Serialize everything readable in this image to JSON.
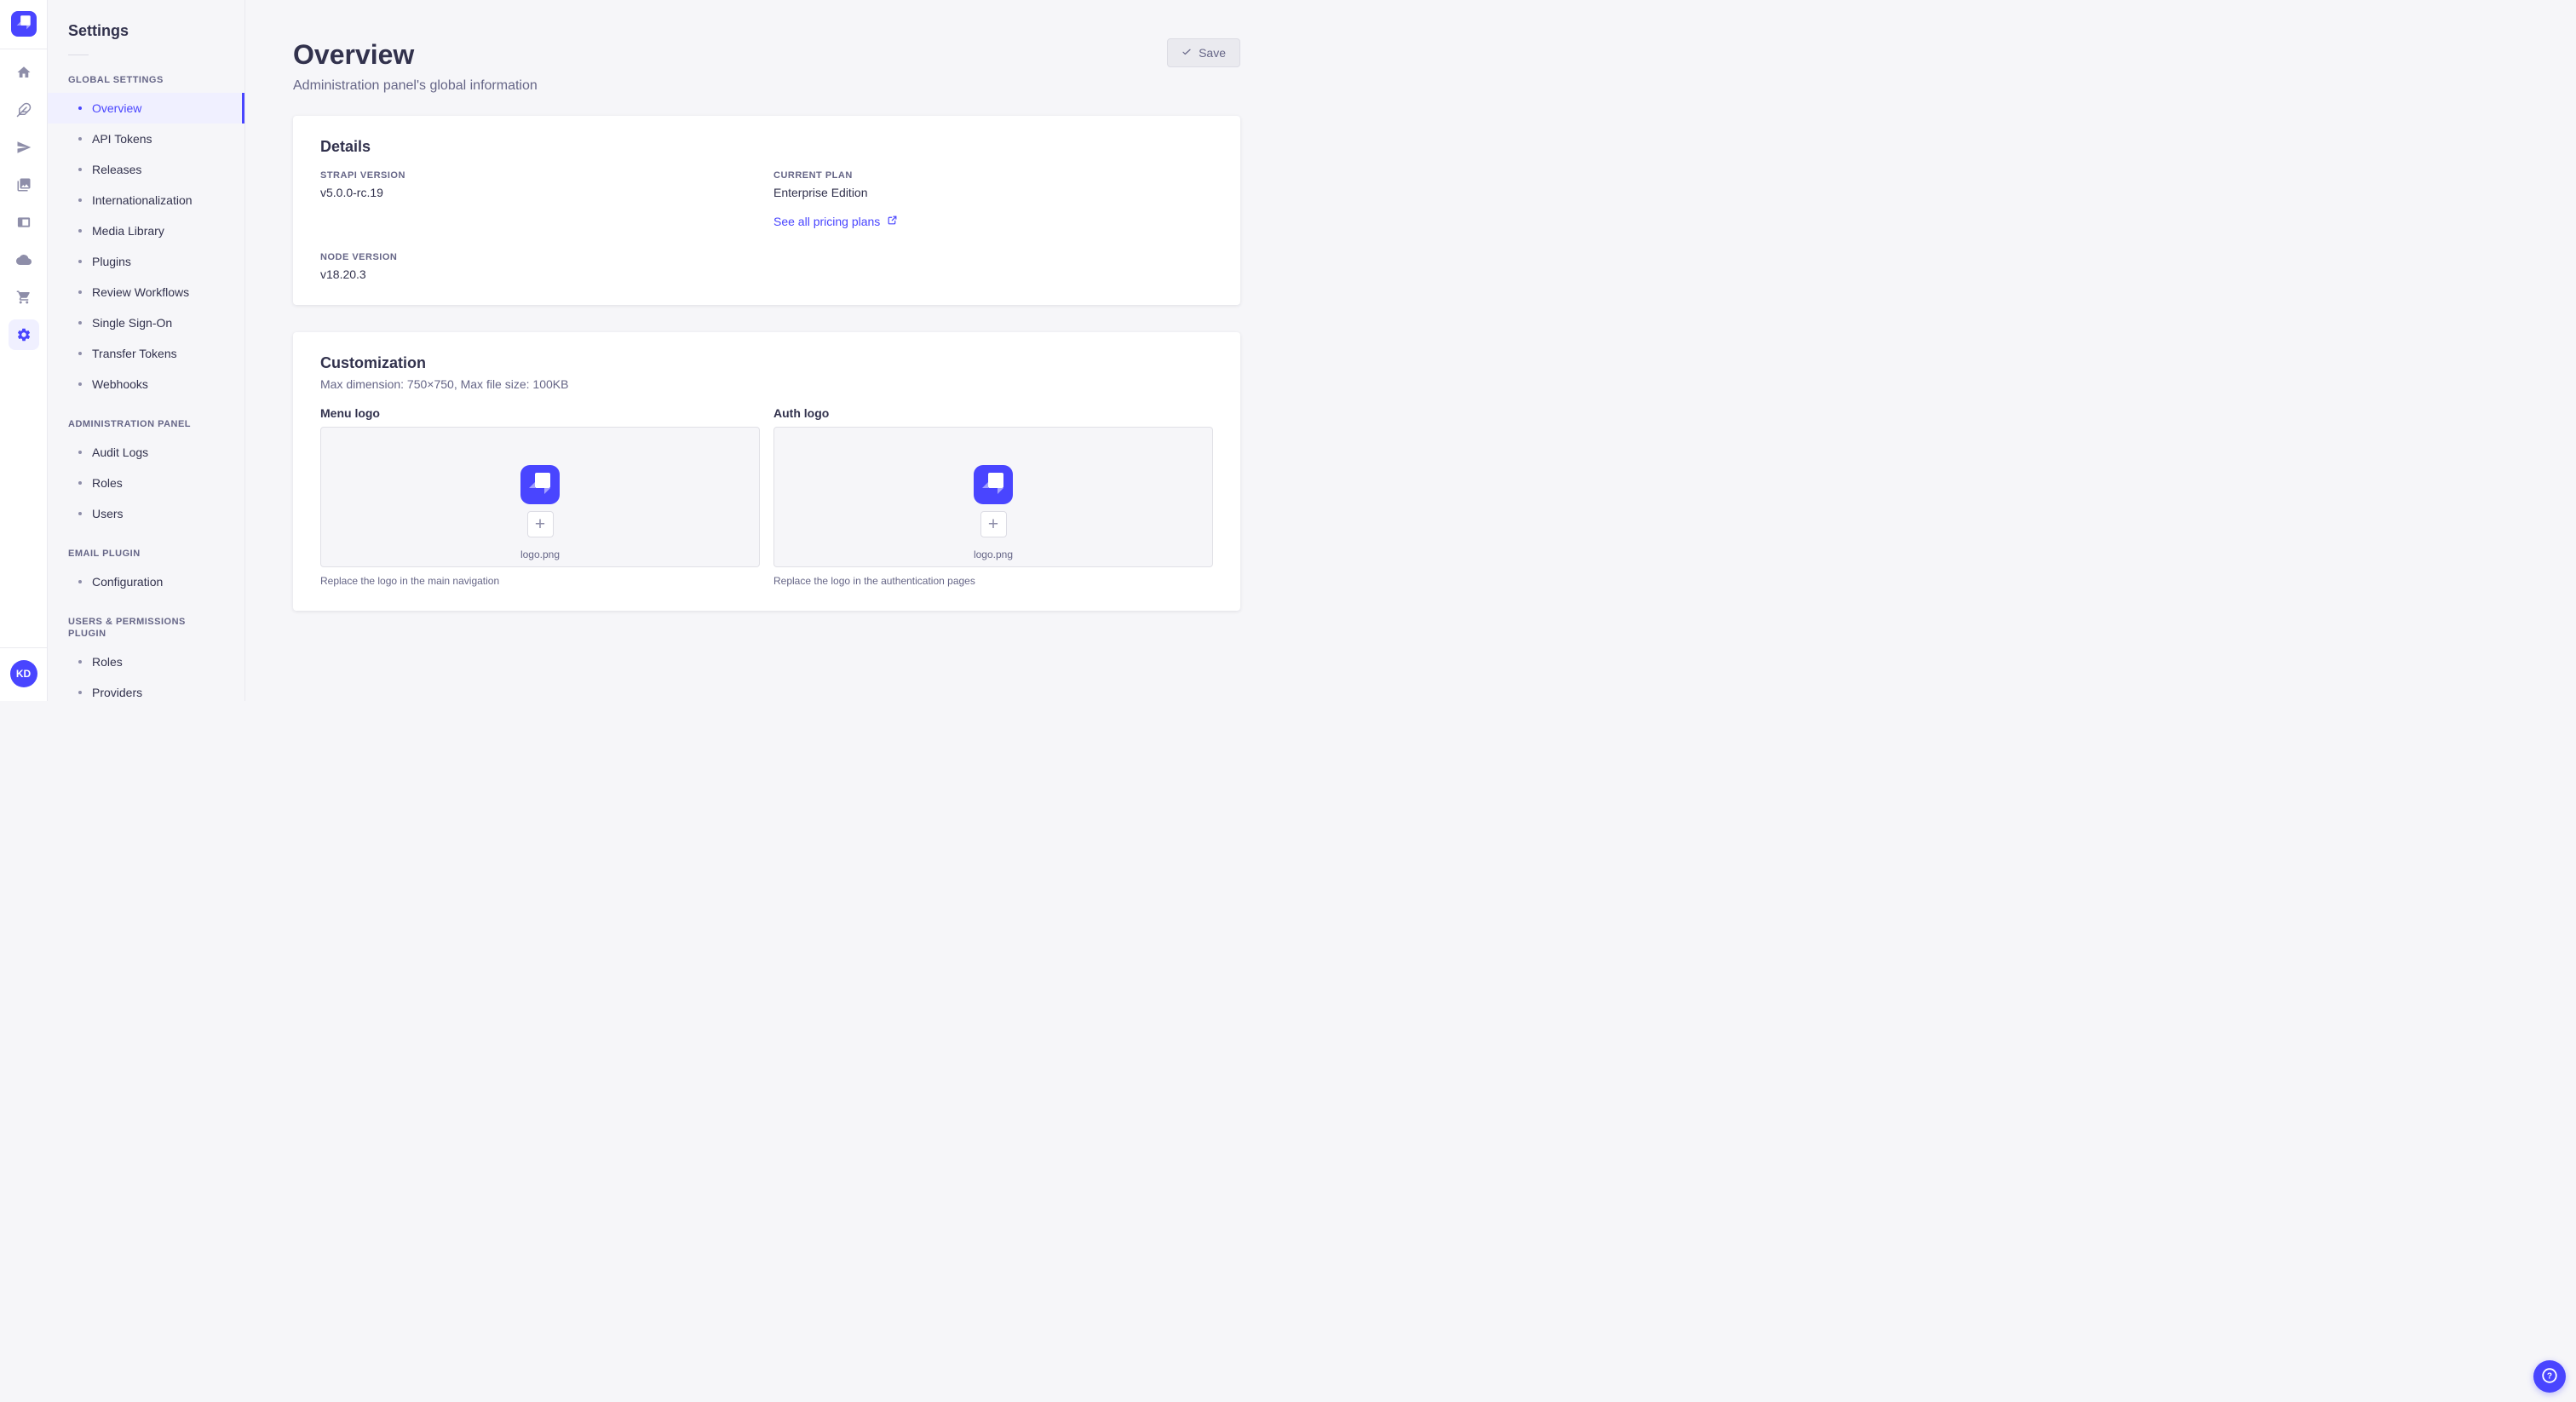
{
  "colors": {
    "primary": "#4945ff",
    "active_bg": "#f0f0ff",
    "text": "#32324d",
    "muted": "#666687"
  },
  "rail": {
    "logo_icon": "strapi-logo",
    "nav_icons": [
      "home",
      "feather",
      "paper-plane",
      "media-library",
      "layout",
      "cloud",
      "cart",
      "settings-gear"
    ],
    "avatar_initials": "KD"
  },
  "sidebar": {
    "title": "Settings",
    "sections": [
      {
        "label": "GLOBAL SETTINGS",
        "items": [
          {
            "label": "Overview",
            "active": true
          },
          {
            "label": "API Tokens",
            "active": false
          },
          {
            "label": "Releases",
            "active": false
          },
          {
            "label": "Internationalization",
            "active": false
          },
          {
            "label": "Media Library",
            "active": false
          },
          {
            "label": "Plugins",
            "active": false
          },
          {
            "label": "Review Workflows",
            "active": false
          },
          {
            "label": "Single Sign-On",
            "active": false
          },
          {
            "label": "Transfer Tokens",
            "active": false
          },
          {
            "label": "Webhooks",
            "active": false
          }
        ]
      },
      {
        "label": "ADMINISTRATION PANEL",
        "items": [
          {
            "label": "Audit Logs",
            "active": false
          },
          {
            "label": "Roles",
            "active": false
          },
          {
            "label": "Users",
            "active": false
          }
        ]
      },
      {
        "label": "EMAIL PLUGIN",
        "items": [
          {
            "label": "Configuration",
            "active": false
          }
        ]
      },
      {
        "label": "USERS & PERMISSIONS PLUGIN",
        "items": [
          {
            "label": "Roles",
            "active": false
          },
          {
            "label": "Providers",
            "active": false
          }
        ]
      }
    ]
  },
  "header": {
    "title": "Overview",
    "subtitle": "Administration panel's global information",
    "save_label": "Save"
  },
  "details_card": {
    "heading": "Details",
    "fields": [
      {
        "label": "STRAPI VERSION",
        "value": "v5.0.0-rc.19"
      },
      {
        "label": "CURRENT PLAN",
        "value": "Enterprise Edition"
      },
      {
        "label": "NODE VERSION",
        "value": "v18.20.3"
      }
    ],
    "pricing_link_label": "See all pricing plans"
  },
  "customization_card": {
    "heading": "Customization",
    "constraints": "Max dimension: 750×750, Max file size: 100KB",
    "menu_logo": {
      "label": "Menu logo",
      "file_name": "logo.png",
      "caption": "Replace the logo in the main navigation"
    },
    "auth_logo": {
      "label": "Auth logo",
      "file_name": "logo.png",
      "caption": "Replace the logo in the authentication pages"
    }
  },
  "fab": {
    "help_icon": "question-mark"
  }
}
